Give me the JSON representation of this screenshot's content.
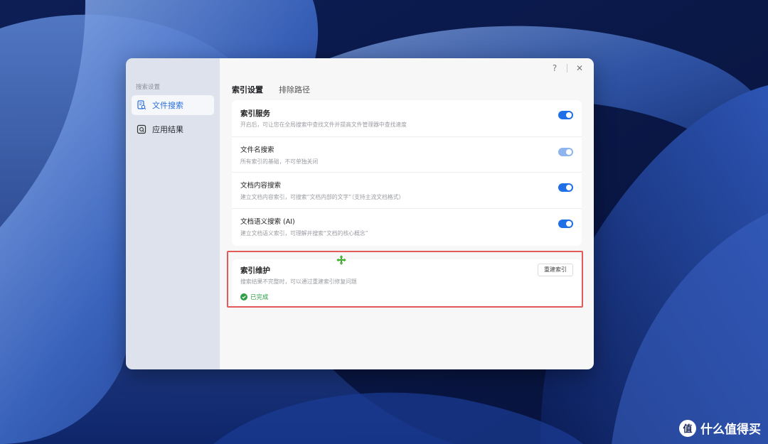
{
  "sidebar": {
    "heading": "搜索设置",
    "items": [
      {
        "label": "文件搜索",
        "icon": "file-search-icon",
        "active": true
      },
      {
        "label": "应用结果",
        "icon": "app-search-icon",
        "active": false
      }
    ]
  },
  "titlebar": {
    "help_label": "?",
    "close_label": "✕"
  },
  "tabs": [
    {
      "label": "索引设置",
      "active": true
    },
    {
      "label": "排除路径",
      "active": false
    }
  ],
  "settings": [
    {
      "title": "索引服务",
      "desc": "开启后，可让您在全局搜索中查找文件并提高文件管理器中查找速度",
      "enabled": true,
      "disabled": false
    },
    {
      "title": "文件名搜索",
      "desc": "所有索引的基础，不可单独关闭",
      "enabled": true,
      "disabled": true
    },
    {
      "title": "文档内容搜索",
      "desc": "建立文档内容索引，可搜索“文档内部的文字”（支持主流文档格式）",
      "enabled": true,
      "disabled": false
    },
    {
      "title": "文档语义搜索 (AI)",
      "desc": "建立文档语义索引，可理解并搜索“文档的核心概念”",
      "enabled": true,
      "disabled": false
    }
  ],
  "maintenance": {
    "title": "索引维护",
    "desc": "搜索结果不完整时，可以通过重建索引修复问题",
    "button_label": "重建索引",
    "status_text": "已完成"
  },
  "watermark": {
    "text": "什么值得买",
    "logo_glyph": "值"
  },
  "colors": {
    "accent": "#1f6fe6",
    "success": "#2f9e44",
    "highlight": "#e35a5a"
  }
}
